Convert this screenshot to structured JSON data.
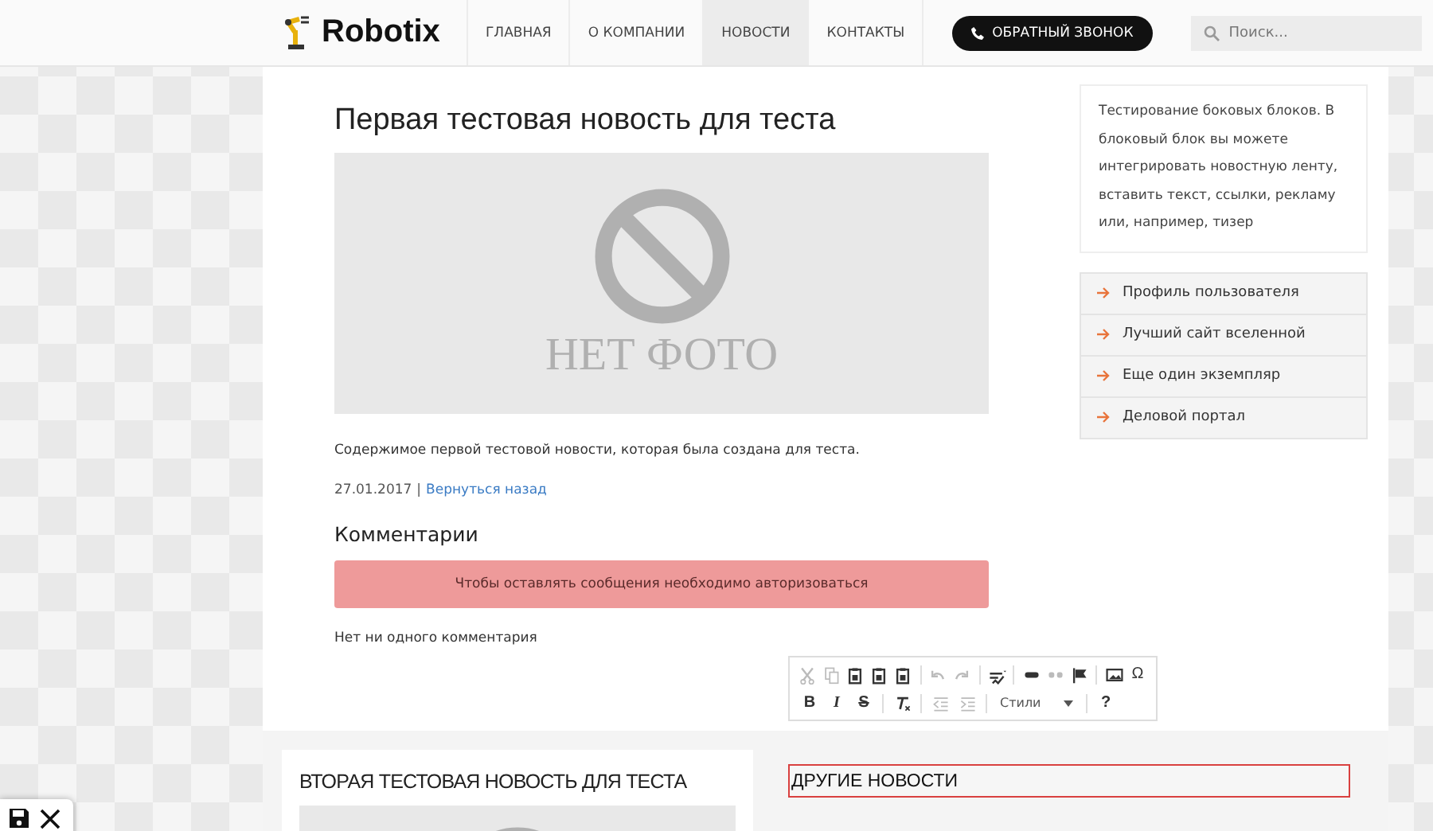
{
  "header": {
    "logo": "Robotix",
    "nav": [
      {
        "label": "ГЛАВНАЯ",
        "selected": false
      },
      {
        "label": "О КОМПАНИИ",
        "selected": false
      },
      {
        "label": "НОВОСТИ",
        "selected": true
      },
      {
        "label": "КОНТАКТЫ",
        "selected": false
      }
    ],
    "call_button": "ОБРАТНЫЙ ЗВОНОК",
    "search": {
      "placeholder": "Поиск..."
    }
  },
  "article": {
    "title": "Первая тестовая новость для теста",
    "image_caption": "НЕТ ФОТО",
    "body": "Содержимое первой тестовой новости, которая была создана для теста.",
    "date": "27.01.2017",
    "separator": "|",
    "back_link": "Вернуться назад",
    "comments_title": "Комментарии",
    "alert": "Чтобы оставлять сообщения необходимо авторизоваться",
    "no_comments": "Нет ни одного комментария"
  },
  "sidebar": {
    "text": "Тестирование боковых блоков. В блоковый блок вы можете интегрировать новостную ленту, вставить текст, ссылки, рекламу или, например, тизер",
    "links": [
      "Профиль пользователя",
      "Лучший сайт вселенной",
      "Еще один экземпляр",
      "Деловой портал"
    ]
  },
  "second_news": {
    "title": "ВТОРАЯ ТЕСТОВАЯ НОВОСТЬ ДЛЯ ТЕСТА"
  },
  "editor": {
    "toolbar_rows": [
      [
        {
          "kind": "cut",
          "disabled": true
        },
        {
          "kind": "copy",
          "disabled": true
        },
        {
          "kind": "paste",
          "disabled": false
        },
        {
          "kind": "paste",
          "disabled": false
        },
        {
          "kind": "paste",
          "disabled": false
        },
        {
          "kind": "sep"
        },
        {
          "kind": "undo",
          "disabled": true
        },
        {
          "kind": "redo",
          "disabled": true
        },
        {
          "kind": "sep"
        },
        {
          "kind": "spell",
          "disabled": false
        },
        {
          "kind": "sep"
        },
        {
          "kind": "link",
          "disabled": false
        },
        {
          "kind": "unlink",
          "disabled": true
        },
        {
          "kind": "flag",
          "disabled": false
        },
        {
          "kind": "sep"
        },
        {
          "kind": "image",
          "disabled": false
        },
        {
          "kind": "glyph",
          "label": "Ω",
          "disabled": false
        }
      ],
      [
        {
          "kind": "bold",
          "label": "B",
          "disabled": false
        },
        {
          "kind": "italic",
          "label": "I",
          "disabled": false
        },
        {
          "kind": "strike",
          "label": "S",
          "disabled": false
        },
        {
          "kind": "sep"
        },
        {
          "kind": "clear",
          "disabled": false
        },
        {
          "kind": "sep"
        },
        {
          "kind": "outdent",
          "disabled": true
        },
        {
          "kind": "indent",
          "disabled": true
        },
        {
          "kind": "sep"
        },
        {
          "kind": "combo",
          "label": "Стили"
        },
        {
          "kind": "sep"
        },
        {
          "kind": "bold",
          "label": "?",
          "disabled": false
        }
      ]
    ],
    "field_value": "ДРУГИЕ НОВОСТИ"
  }
}
